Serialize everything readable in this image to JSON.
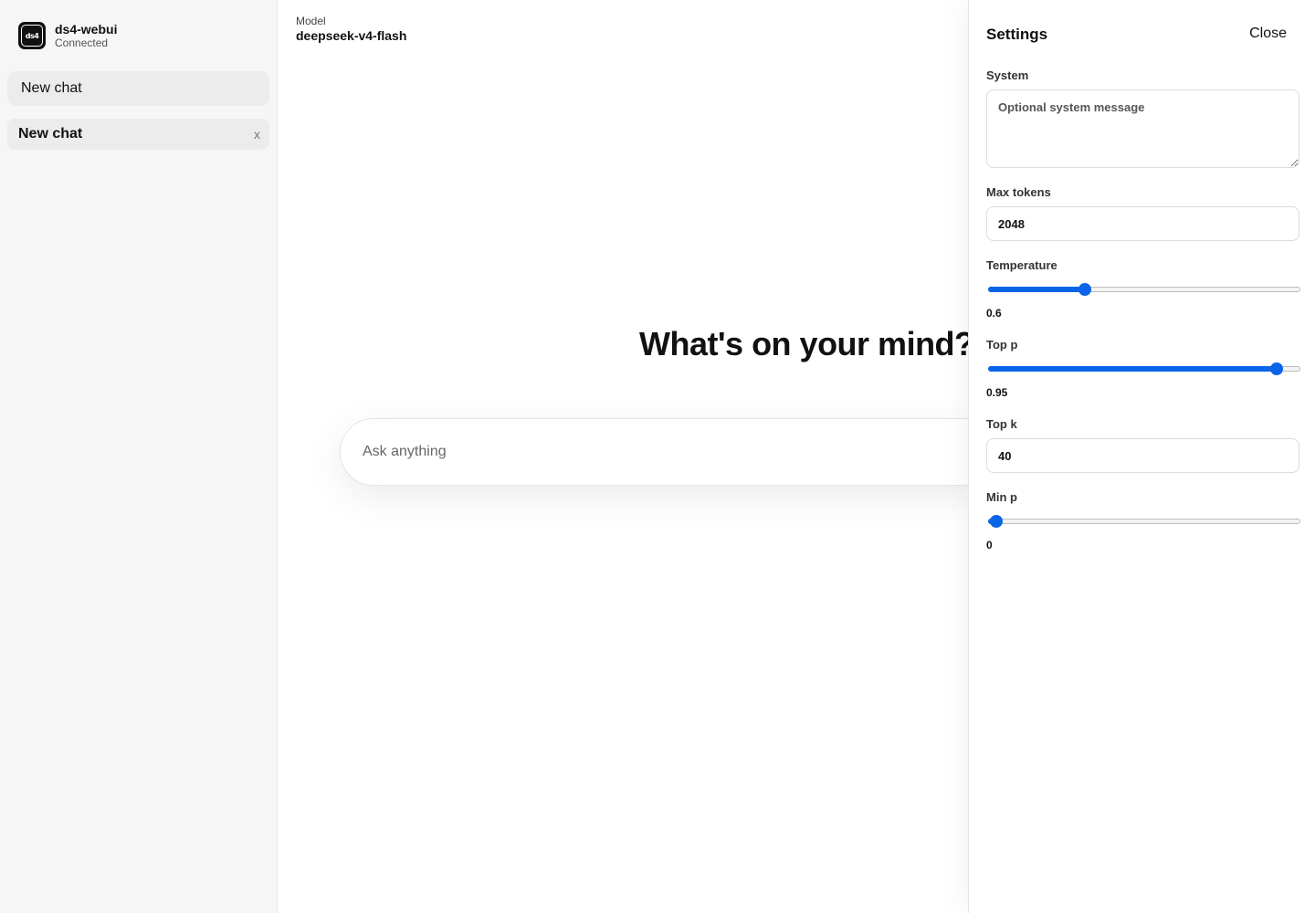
{
  "sidebar": {
    "app_name": "ds4-webui",
    "status": "Connected",
    "logo_text": "ds4",
    "new_chat_label": "New chat",
    "chats": [
      {
        "label": "New chat",
        "close": "x"
      }
    ]
  },
  "main": {
    "model_label": "Model",
    "model_name": "deepseek-v4-flash",
    "headline": "What's on your mind?",
    "prompt_placeholder": "Ask anything"
  },
  "settings": {
    "title": "Settings",
    "close_label": "Close",
    "system": {
      "label": "System",
      "placeholder": "Optional system message"
    },
    "max_tokens": {
      "label": "Max tokens",
      "value": "2048"
    },
    "temperature": {
      "label": "Temperature",
      "value": "0.6",
      "fraction": 0.31
    },
    "top_p": {
      "label": "Top p",
      "value": "0.95",
      "fraction": 0.925
    },
    "top_k": {
      "label": "Top k",
      "value": "40"
    },
    "min_p": {
      "label": "Min p",
      "value": "0",
      "fraction": 0.025
    }
  },
  "colors": {
    "accent": "#0a64e8",
    "sidebar_bg": "#f6f6f6"
  }
}
